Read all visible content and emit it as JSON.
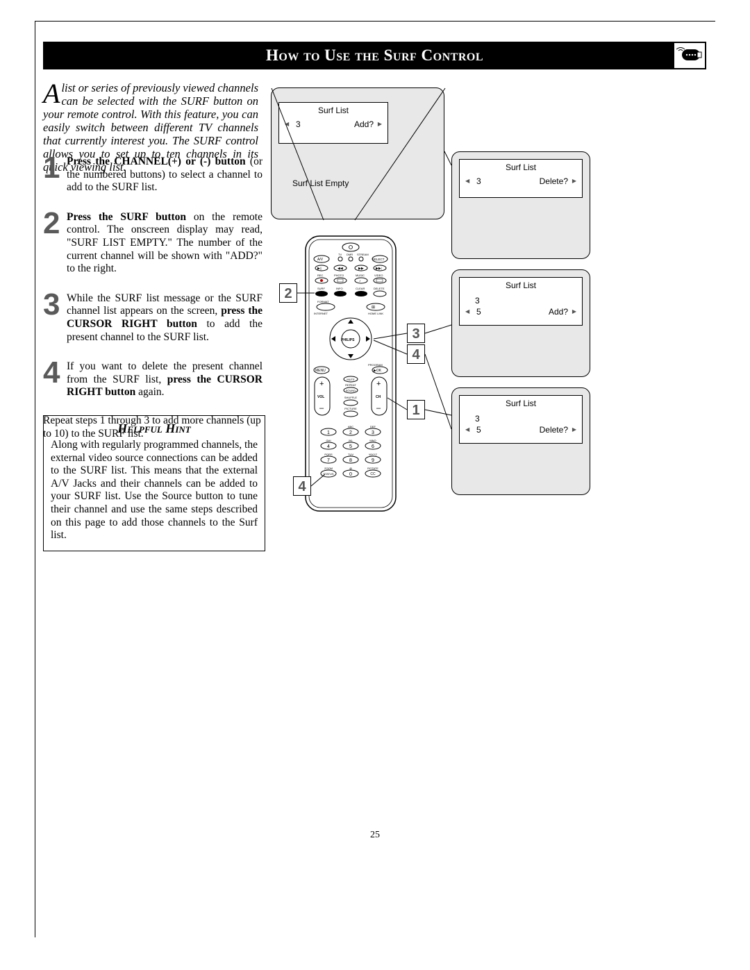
{
  "title": "How to Use the Surf Control",
  "intro": "list or series of previously viewed channels can be selected with the SURF button on your remote control.  With this feature, you can easily switch between different TV channels that currently interest you.  The SURF control allows you to set up to ten channels in its quick viewing list.",
  "intro_dropcap": "A",
  "steps": [
    {
      "num": "1",
      "html": "<b>Press the CHANNEL(+) or (-) button</b> (or the numbered buttons) to select a channel to add to the SURF list."
    },
    {
      "num": "2",
      "html": "<b>Press the SURF button</b> on the remote control.  The onscreen display may read, \"SURF LIST EMPTY.\" The number of the current channel will be shown with \"ADD?\" to the right."
    },
    {
      "num": "3",
      "html": "While the SURF list message or the SURF channel list appears on the screen, <b>press the CURSOR RIGHT button</b> to add the present channel to the SURF list."
    },
    {
      "num": "4",
      "html": "If you want to delete the present channel from the SURF list, <b>press the CURSOR RIGHT button</b> again."
    }
  ],
  "repeat": "Repeat steps 1 through 3 to add more channels (up to 10) to the SURF list.",
  "hint_title": "Helpful Hint",
  "hint_text": "Along with regularly programmed channels, the external video source connections can be added to the SURF list.  This means that the external A/V Jacks and their channels can be added to your SURF list.  Use the Source button to tune their channel and use the same steps described on this page to add those channels to the Surf list.",
  "osd": {
    "surf_list": "Surf List",
    "add": "Add?",
    "delete": "Delete?",
    "empty": "Surf List Empty",
    "ch3": "3",
    "ch5": "5"
  },
  "callouts": {
    "c1": "1",
    "c2": "2",
    "c3": "3",
    "c4a": "4",
    "c4b": "4"
  },
  "remote": {
    "top_labels": [
      "TV",
      "DMR",
      "STREAM"
    ],
    "av": "A/V",
    "select": "SELECT",
    "row2": [
      "REC",
      "PHOTO",
      "MUSIC",
      "VIDEO"
    ],
    "row3": [
      "SURF",
      "INFO",
      "CLEAR",
      "DELETE"
    ],
    "format": "FORMAT",
    "internet": "INTERNET",
    "homelink": "HOME LINK",
    "brand": "PHILIPS",
    "menu": "MENU",
    "program": "PROGRAM",
    "ok": "OK",
    "mute": "MUTE",
    "repeat": "REPEAT",
    "sound": "SOUND",
    "shuffle": "SHUFFLE",
    "picture": "PICTURE",
    "vol": "VOL",
    "ch": "CH",
    "abc": "ABC",
    "def": "DEF",
    "ghi": "GHI",
    "jkl": "JKL",
    "mno": "MNO",
    "pqrs": "PQRS",
    "tuv": "TUV",
    "wxyz": "WXYZ",
    "zoom": "ZOOM",
    "at": "@",
    "rotate": "ROTATE",
    "status": "STATUS",
    "cc": "CC"
  },
  "page_num": "25"
}
